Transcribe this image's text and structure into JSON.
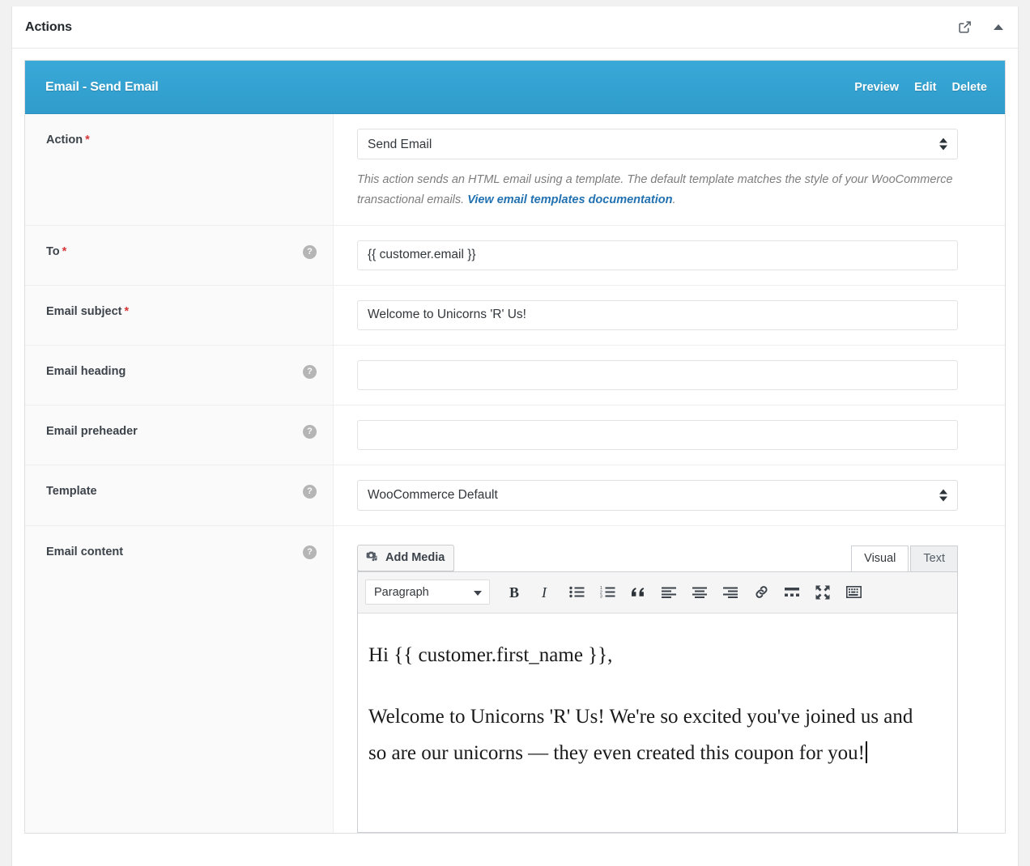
{
  "metabox": {
    "title": "Actions",
    "expand_icon": "external-link-icon",
    "collapse_icon": "triangle-up-icon"
  },
  "action_card": {
    "title": "Email - Send Email",
    "links": [
      {
        "label": "Preview",
        "name": "preview-link"
      },
      {
        "label": "Edit",
        "name": "edit-link"
      },
      {
        "label": "Delete",
        "name": "delete-link"
      }
    ]
  },
  "fields": {
    "action": {
      "label": "Action",
      "required": "*",
      "value": "Send Email",
      "options": [
        "Send Email"
      ],
      "description_part1": "This action sends an HTML email using a template. The default template matches the style of your WooCommerce transactional emails. ",
      "description_link": "View email templates documentation",
      "description_part2": "."
    },
    "to": {
      "label": "To",
      "required": "*",
      "value": "{{ customer.email }}",
      "help": "?"
    },
    "email_subject": {
      "label": "Email subject",
      "required": "*",
      "value": "Welcome to Unicorns 'R' Us!"
    },
    "email_heading": {
      "label": "Email heading",
      "value": "",
      "help": "?"
    },
    "email_preheader": {
      "label": "Email preheader",
      "value": "",
      "help": "?"
    },
    "template": {
      "label": "Template",
      "value": "WooCommerce Default",
      "options": [
        "WooCommerce Default"
      ],
      "help": "?"
    },
    "email_content": {
      "label": "Email content",
      "help": "?"
    }
  },
  "editor": {
    "add_media_label": "Add Media",
    "add_media_icon": "media-camera-music-icon",
    "tabs": [
      {
        "label": "Visual",
        "name": "tab-visual",
        "active": true
      },
      {
        "label": "Text",
        "name": "tab-text",
        "active": false
      }
    ],
    "format_select": {
      "value": "Paragraph",
      "options": [
        "Paragraph"
      ]
    },
    "toolbar_buttons": [
      {
        "name": "bold-icon",
        "title": "Bold"
      },
      {
        "name": "italic-icon",
        "title": "Italic"
      },
      {
        "name": "bulleted-list-icon",
        "title": "Bulleted list"
      },
      {
        "name": "numbered-list-icon",
        "title": "Numbered list"
      },
      {
        "name": "blockquote-icon",
        "title": "Blockquote"
      },
      {
        "name": "align-left-icon",
        "title": "Align left"
      },
      {
        "name": "align-center-icon",
        "title": "Align center"
      },
      {
        "name": "align-right-icon",
        "title": "Align right"
      },
      {
        "name": "link-icon",
        "title": "Insert link"
      },
      {
        "name": "read-more-icon",
        "title": "Insert Read More tag"
      },
      {
        "name": "fullscreen-icon",
        "title": "Distraction-free writing mode"
      },
      {
        "name": "toolbar-toggle-icon",
        "title": "Toolbar Toggle"
      }
    ],
    "content": {
      "paragraph_1": "Hi {{ customer.first_name }},",
      "paragraph_2": "Welcome to Unicorns 'R' Us! We're so excited you've joined us and so are our unicorns — they even created this coupon for you!"
    }
  },
  "colors": {
    "accent_blue": "#2f9ccb",
    "link_blue": "#2271b1",
    "required_red": "#d63638",
    "label_bg": "#fafafa",
    "page_bg": "#f1f1f1"
  }
}
